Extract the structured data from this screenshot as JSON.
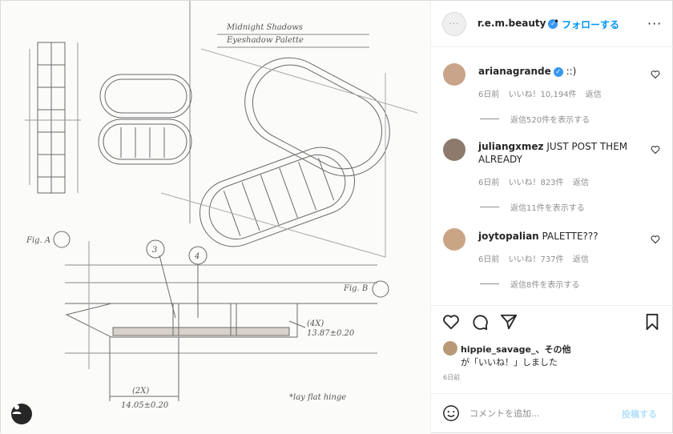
{
  "post": {
    "author": "r.e.m.beauty",
    "author_avatar_text": "···",
    "follow_separator": "•",
    "follow_label": "フォローする",
    "more_label": "···",
    "sketch_labels": {
      "title_line1": "Midnight Shadows",
      "title_line2": "Eyeshadow Palette",
      "fig_a": "Fig. A",
      "fig_b": "Fig. B",
      "callout_3": "3",
      "callout_4": "4",
      "dim_4x": "(4X)",
      "dim_value": "13.87±0.20",
      "dim_2x": "(2X)",
      "dim_bottom": "14.05±0.20",
      "hinge_note": "*lay flat hinge"
    }
  },
  "comments": [
    {
      "user": "arianagrande",
      "verified": true,
      "text": "::)",
      "time": "6日前",
      "likes": "いいね！10,194件",
      "reply": "返信",
      "view_replies": "返信520件を表示する",
      "avatar_color": "#c9a38a"
    },
    {
      "user": "juliangxmez",
      "verified": false,
      "text": "JUST POST THEM ALREADY",
      "time": "6日前",
      "likes": "いいね！823件",
      "reply": "返信",
      "view_replies": "返信11件を表示する",
      "avatar_color": "#8d7a6c"
    },
    {
      "user": "joytopalian",
      "verified": false,
      "text": "PALETTE???",
      "time": "6日前",
      "likes": "いいね！737件",
      "reply": "返信",
      "view_replies": "返信8件を表示する",
      "avatar_color": "#caa585"
    }
  ],
  "likes": {
    "user": "hippie_savage_",
    "suffix": "、その他",
    "line2": "が「いいね！」しました"
  },
  "post_time": "6日前",
  "add_comment": {
    "placeholder": "コメントを追加...",
    "post_label": "投稿する"
  },
  "colors": {
    "accent": "#0095f6",
    "verified": "#3897f0",
    "muted": "#8e8e8e",
    "post_disabled": "#b2dffc"
  },
  "icons": {
    "heart": "heart-icon",
    "comment": "comment-icon",
    "share": "paper-plane-icon",
    "save": "bookmark-icon",
    "emoji": "smiley-icon",
    "user_tag": "user-tag-icon"
  }
}
